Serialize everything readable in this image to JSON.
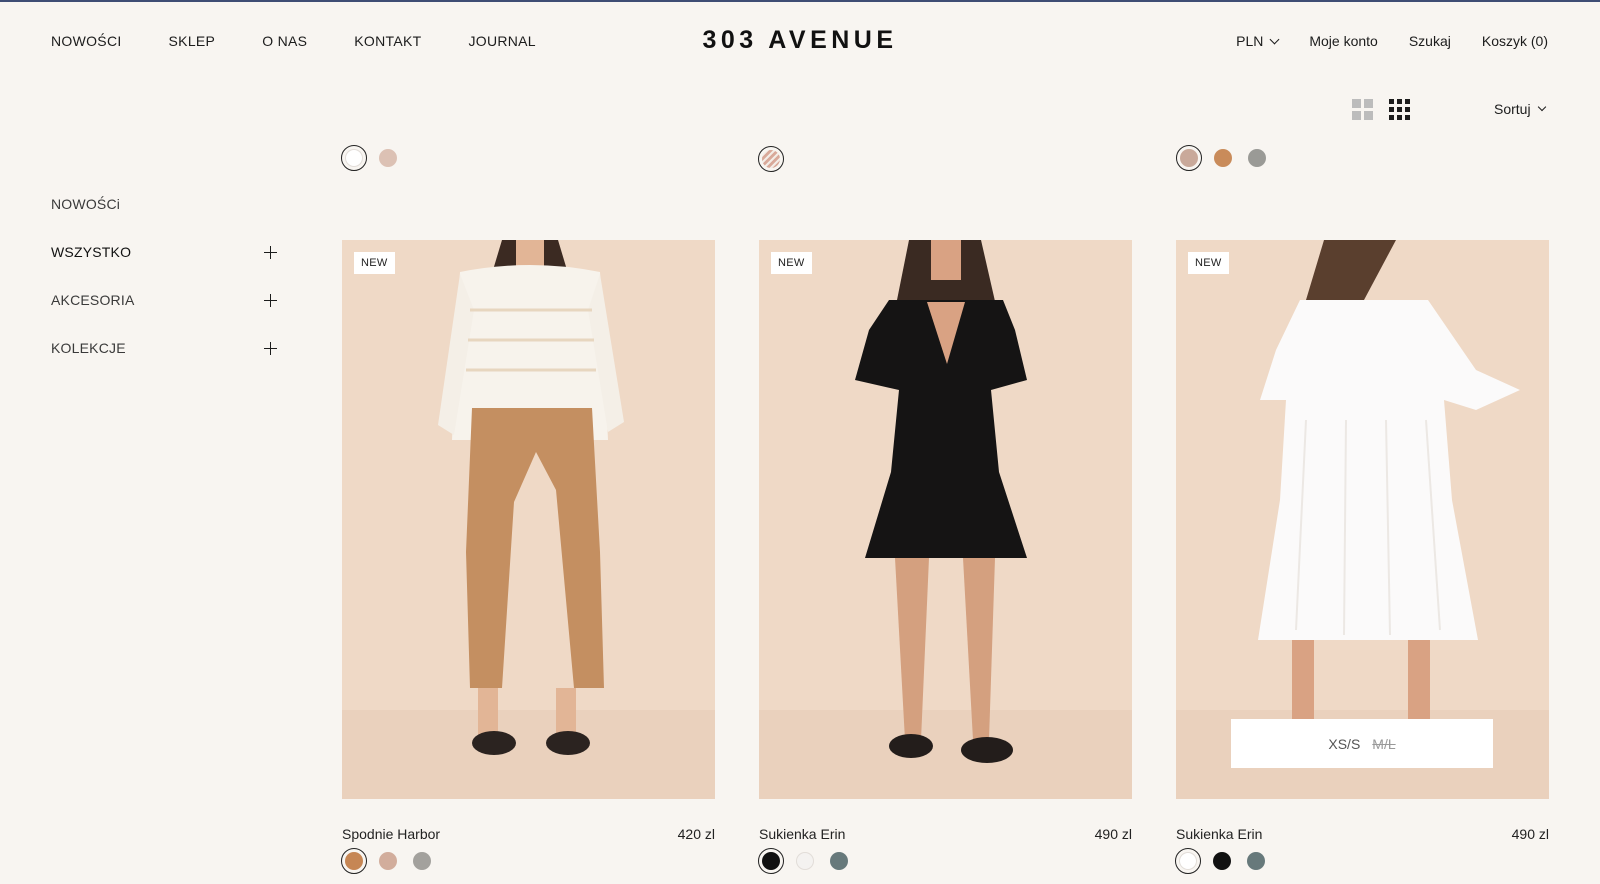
{
  "header": {
    "nav_left": [
      "NOWOŚCI",
      "SKLEP",
      "O NAS",
      "KONTAKT",
      "JOURNAL"
    ],
    "logo": "303 AVENUE",
    "currency": "PLN",
    "account": "Moje konto",
    "search": "Szukaj",
    "cart": "Koszyk (0)"
  },
  "toolbar": {
    "sort_label": "Sortuj",
    "icons": [
      "grid-2-icon",
      "grid-3-icon"
    ]
  },
  "sidebar": {
    "items": [
      {
        "label": "NOWOŚCi",
        "expandable": false
      },
      {
        "label": "WSZYSTKO",
        "expandable": true
      },
      {
        "label": "AKCESORIA",
        "expandable": true
      },
      {
        "label": "KOLEKCJE",
        "expandable": true
      }
    ]
  },
  "top_swatches": [
    [
      {
        "color": "#ffffff",
        "selected": true
      },
      {
        "color": "#dcc1b4",
        "selected": false
      }
    ],
    [
      {
        "color": "#d9a99a",
        "selected": true,
        "pattern": "zigzag"
      }
    ],
    [
      {
        "color": "#c9a99a",
        "selected": true
      },
      {
        "color": "#c98b5a",
        "selected": false
      },
      {
        "color": "#9a9a96",
        "selected": false
      }
    ]
  ],
  "products": [
    {
      "badge": "NEW",
      "name": "Spodnie Harbor",
      "price": "420 zl",
      "swatches": [
        {
          "color": "#c68654",
          "selected": true
        },
        {
          "color": "#d2ad9c",
          "selected": false
        },
        {
          "color": "#a3a19d",
          "selected": false
        }
      ]
    },
    {
      "badge": "NEW",
      "name": "Sukienka Erin",
      "price": "490 zl",
      "swatches": [
        {
          "color": "#111111",
          "selected": true
        },
        {
          "color": "#f4f2f0",
          "selected": false
        },
        {
          "color": "#67797b",
          "selected": false
        }
      ]
    },
    {
      "badge": "NEW",
      "name": "Sukienka Erin",
      "price": "490 zl",
      "swatches": [
        {
          "color": "#ffffff",
          "selected": true
        },
        {
          "color": "#111111",
          "selected": false
        },
        {
          "color": "#67797b",
          "selected": false
        }
      ],
      "sizes": {
        "available": "XS/S",
        "unavailable": "M/L"
      }
    }
  ],
  "colors": {
    "background": "#f8f5f1",
    "photo_background": "#efd9c6",
    "top_accent": "#3e4d74"
  }
}
